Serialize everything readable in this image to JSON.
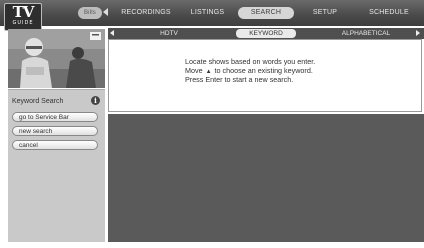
{
  "logo": {
    "line1": "TV",
    "line2": "GUIDE"
  },
  "top_menu": {
    "first": "Bills",
    "recordings": "RECORDINGS",
    "listings": "LISTINGS",
    "search": "SEARCH",
    "setup": "SETUP",
    "schedule": "SCHEDULE",
    "selected": "SEARCH"
  },
  "sub_tabs": {
    "hdtv": "HDTV",
    "keyword": "KEYWORD",
    "alphabetical": "ALPHABETICAL",
    "selected": "KEYWORD"
  },
  "info": {
    "line1": "Locate shows based on words you enter.",
    "line2_pre": "Move",
    "line2_arrow": "▲",
    "line2_post": "to choose an existing keyword.",
    "line3": "Press Enter to start a new search."
  },
  "sidebar": {
    "title": "Keyword Search",
    "info_icon": "i",
    "buttons": {
      "service_bar": "go to Service Bar",
      "new_search": "new search",
      "cancel": "cancel"
    }
  },
  "colors": {
    "top_bar": "#4a4a4a",
    "sidebar": "#c9c9c9",
    "results_area": "#5a5a5a",
    "selected_tab": "#d6d6d6"
  }
}
